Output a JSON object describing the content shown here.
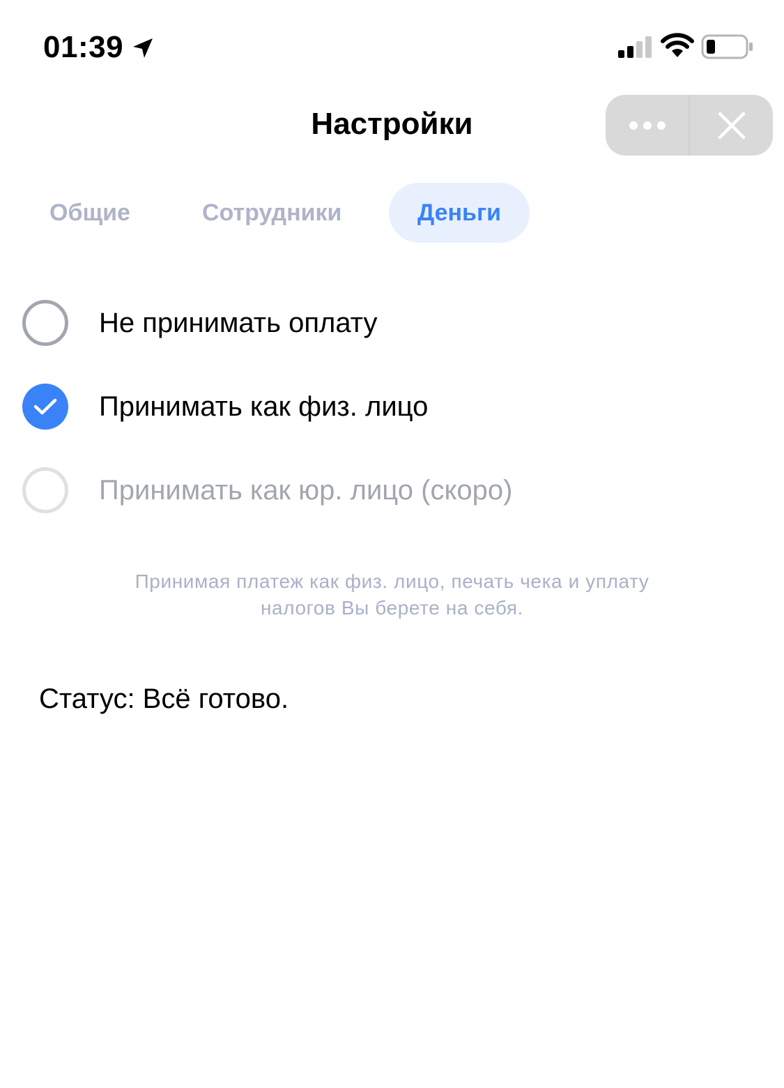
{
  "status_bar": {
    "time": "01:39",
    "icons": [
      "location-arrow-icon",
      "cellular-signal-icon",
      "wifi-icon",
      "battery-icon"
    ]
  },
  "header": {
    "title": "Настройки",
    "more_icon": "more-dots-icon",
    "close_icon": "close-icon"
  },
  "tabs": [
    {
      "label": "Общие",
      "active": false
    },
    {
      "label": "Сотрудники",
      "active": false
    },
    {
      "label": "Деньги",
      "active": true
    }
  ],
  "payment_options": [
    {
      "label": "Не принимать оплату",
      "checked": false,
      "disabled": false
    },
    {
      "label": "Принимать как физ. лицо",
      "checked": true,
      "disabled": false
    },
    {
      "label": "Принимать как юр. лицо (скоро)",
      "checked": false,
      "disabled": true
    }
  ],
  "hint": "Принимая платеж как физ. лицо, печать чека и уплату налогов Вы берете на себя.",
  "status": "Статус: Всё готово.",
  "colors": {
    "accent": "#3a82f7",
    "tab_active_bg": "#e8f0fe",
    "muted_text": "#aeb4c8",
    "disabled_text": "#a2a6ae"
  }
}
